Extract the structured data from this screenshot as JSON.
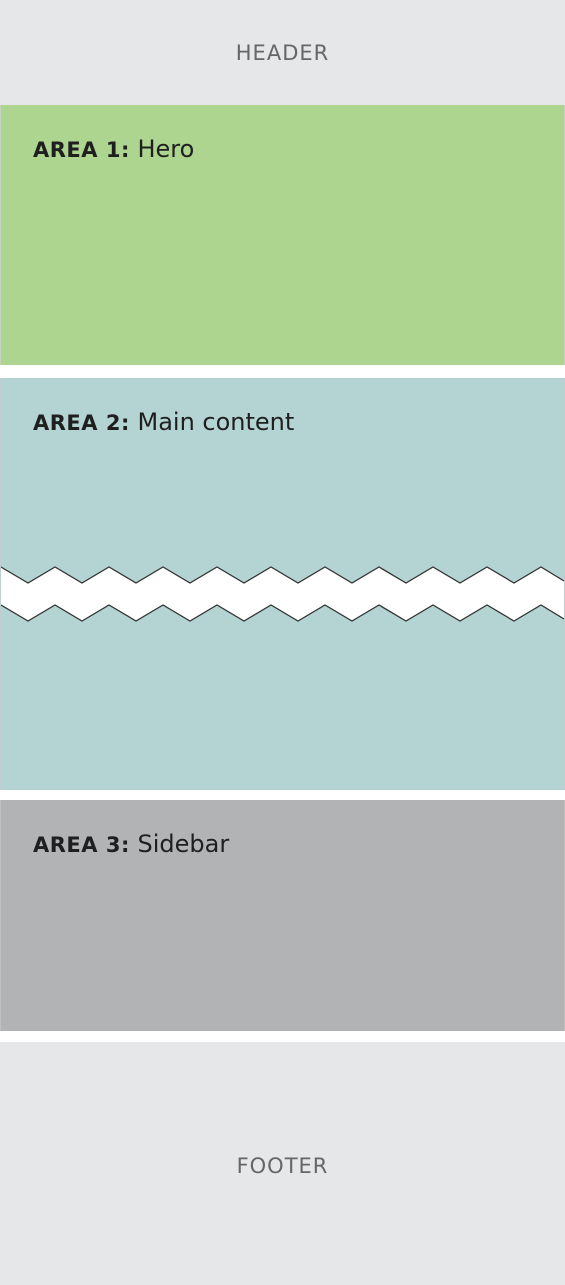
{
  "header": {
    "label": "HEADER"
  },
  "areas": [
    {
      "prefix": "AREA 1:",
      "title": "Hero",
      "color": "#add590"
    },
    {
      "prefix": "AREA 2:",
      "title": "Main content",
      "color": "#b4d4d3"
    },
    {
      "prefix": "AREA 3:",
      "title": "Sidebar",
      "color": "#b2b3b5"
    }
  ],
  "footer": {
    "label": "FOOTER"
  },
  "colors": {
    "header_footer_bg": "#e6e7e9",
    "header_footer_text": "#666666",
    "label_text": "#1f1f1f",
    "break_line": "#333333"
  }
}
